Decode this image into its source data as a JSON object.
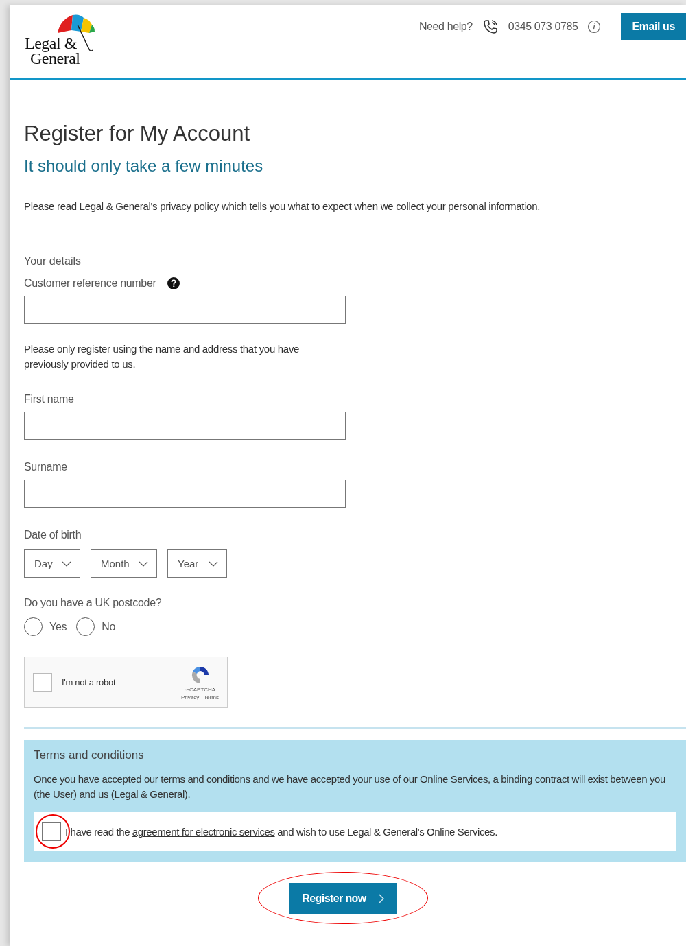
{
  "header": {
    "logo_line_1": "Legal &",
    "logo_line_2": "General",
    "help_label": "Need help?",
    "phone": "0345 073 0785",
    "email_button": "Email us"
  },
  "title": "Register for My Account",
  "subtitle": "It should only take a few minutes",
  "intro": {
    "before": "Please read Legal & General's",
    "link": "privacy policy",
    "after": "which tells you what to expect when we collect your personal information."
  },
  "section_title": "Your details",
  "reference": {
    "label": "Customer reference number"
  },
  "note": "Please only register using the name and address that you have previously provided to us.",
  "name_fields": [
    {
      "label": "First name"
    },
    {
      "label": "Surname"
    }
  ],
  "date_of_birth": {
    "label": "Date of birth",
    "selects": [
      {
        "text": "Day"
      },
      {
        "text": "Month"
      },
      {
        "text": "Year"
      }
    ]
  },
  "postcode": {
    "question": "Do you have a UK postcode?",
    "options": [
      {
        "label": "Yes",
        "selected": false
      },
      {
        "label": "No",
        "selected": false
      }
    ]
  },
  "captcha": {
    "label": "I'm not a robot",
    "checked": false,
    "brand": "reCAPTCHA",
    "links": "Privacy - Terms"
  },
  "terms": {
    "title": "Terms and conditions",
    "body": "Once you have accepted our terms and conditions and we have accepted your use of our Online Services, a binding contract will exist between you (the User) and us (Legal & General).",
    "agreement": {
      "before": "I have read the",
      "link": "agreement for electronic services",
      "after": "and wish to use Legal & General's Online Services.",
      "checked": false,
      "highlighted": true
    }
  },
  "submit": {
    "label": "Register now",
    "highlighted": true
  }
}
